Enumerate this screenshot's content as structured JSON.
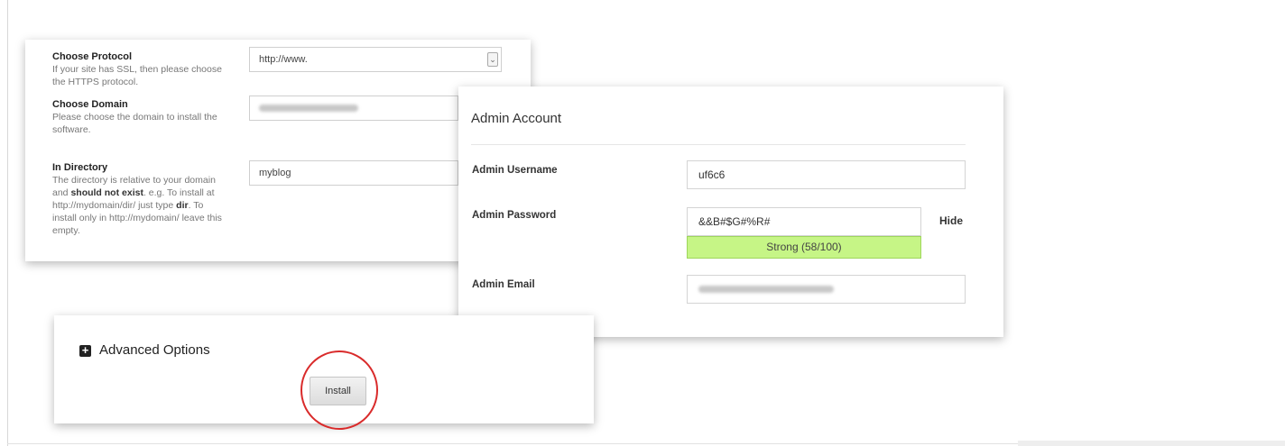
{
  "settings": {
    "protocol": {
      "title": "Choose Protocol",
      "description": "If your site has SSL, then please choose the HTTPS protocol.",
      "value": "http://www."
    },
    "domain": {
      "title": "Choose Domain",
      "description": "Please choose the domain to install the software."
    },
    "directory": {
      "title": "In Directory",
      "desc_1": "The directory is relative to your domain and ",
      "desc_bold_1": "should not exist",
      "desc_2": ". e.g. To install at http://mydomain/dir/ just type ",
      "desc_bold_2": "dir",
      "desc_3": ". To install only in http://mydomain/ leave this empty.",
      "value": "myblog"
    }
  },
  "admin": {
    "title": "Admin Account",
    "username_label": "Admin Username",
    "username_value": "uf6c6",
    "password_label": "Admin Password",
    "password_value": "&&B#$G#%R#",
    "hide_label": "Hide",
    "strength_label": "Strong (58/100)",
    "email_label": "Admin Email"
  },
  "advanced": {
    "title": "Advanced Options",
    "install_label": "Install"
  },
  "colors": {
    "strength_fill": "#c6f586",
    "highlight_ring": "#d92b2b"
  },
  "icons": {
    "advanced_toggle": "plus-square-icon",
    "select_arrow": "chevron-down-icon"
  }
}
